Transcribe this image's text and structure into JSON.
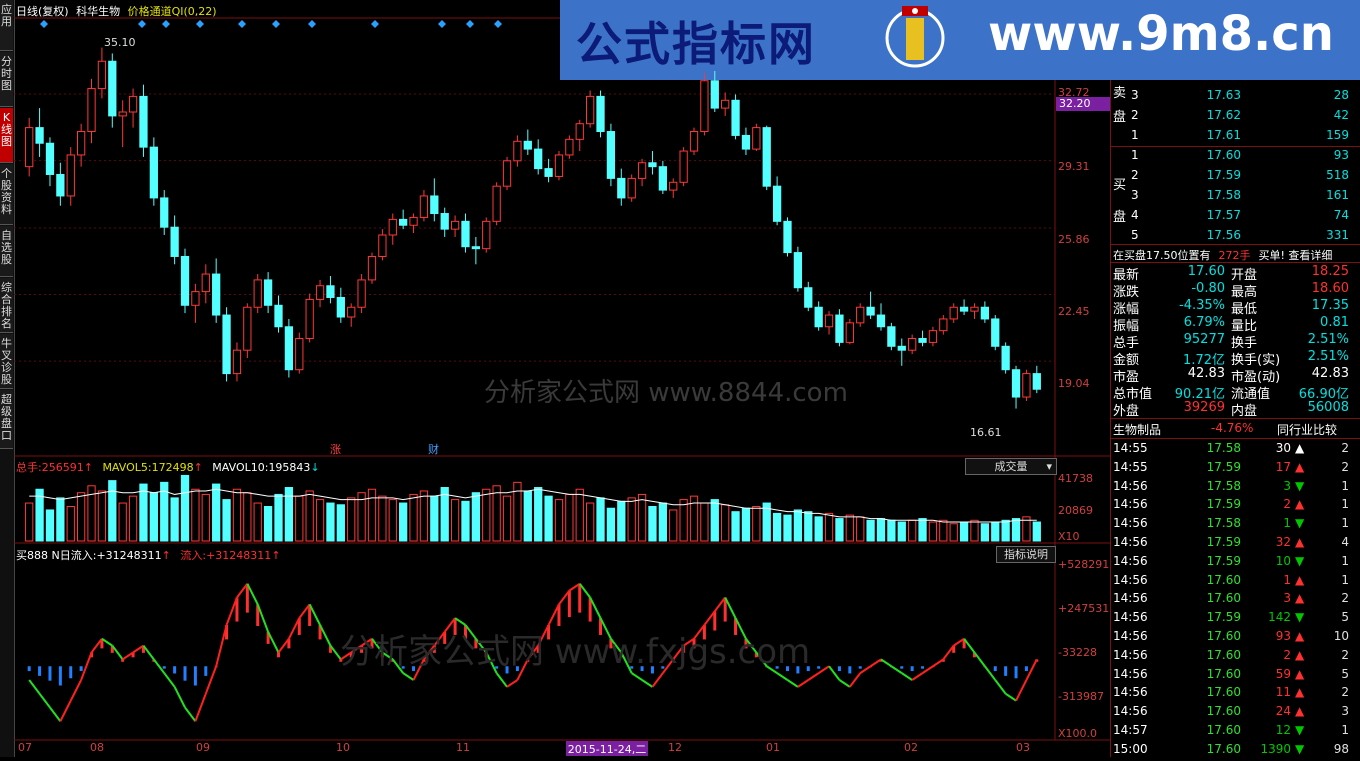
{
  "left_tabs": [
    {
      "label": "应用",
      "active": false
    },
    {
      "label": "分时图",
      "active": false
    },
    {
      "label": "K线图",
      "active": true
    },
    {
      "label": "个股资料",
      "active": false
    },
    {
      "label": "自选股",
      "active": false
    },
    {
      "label": "综合排名",
      "active": false
    },
    {
      "label": "牛叉诊股",
      "active": false
    },
    {
      "label": "超级盘口",
      "active": false
    }
  ],
  "header": {
    "period": "日线(复权)",
    "stock": "科华生物",
    "indicator": "价格通道QI(0,22)"
  },
  "banner": {
    "title": "公式指标网",
    "url": "www.9m8.cn",
    "logo_text": "www.9m8.cn"
  },
  "price_axis": {
    "labels": [
      "32.72",
      "29.31",
      "25.86",
      "22.45",
      "19.04"
    ],
    "current": "32.20"
  },
  "price_range": {
    "min": 15.0,
    "max": 36.0
  },
  "annotations": {
    "high": "35.10",
    "low": "16.61",
    "marker1": "涨",
    "marker2": "财"
  },
  "watermark1": "分析家公式网 www.8844.com",
  "watermark2": "分析家公式网 www.fxjgs.com",
  "volume_header": {
    "total_label": "总手:",
    "total_value": "256591",
    "mavol5_label": "MAVOL5:",
    "mavol5_value": "172498",
    "mavol10_label": "MAVOL10:",
    "mavol10_value": "195843",
    "dropdown": "成交量"
  },
  "volume_axis": {
    "labels": [
      "41738",
      "20869"
    ],
    "multiplier": "X10"
  },
  "indicator_header": {
    "name": "买888",
    "n_label": "N日流入:",
    "n_value": "+31248311",
    "flow_label": "流入:",
    "flow_value": "+31248311",
    "help_button": "指标说明"
  },
  "indicator_axis": {
    "labels": [
      "+528291",
      "+247531",
      "-33228",
      "-313987"
    ],
    "multiplier": "X100.0"
  },
  "x_axis": {
    "labels": [
      "07",
      "08",
      "09",
      "10",
      "11",
      "12",
      "01",
      "02",
      "03"
    ],
    "cursor_date": "2015-11-24,二"
  },
  "chart_data": {
    "type": "candlestick",
    "title": "科华生物 日线(复权)",
    "candles": [
      [
        29.0,
        31.5,
        28.5,
        31.0
      ],
      [
        31.0,
        32.0,
        29.5,
        30.2
      ],
      [
        30.2,
        30.5,
        28.0,
        28.6
      ],
      [
        28.6,
        29.2,
        27.0,
        27.5
      ],
      [
        27.5,
        30.0,
        27.0,
        29.6
      ],
      [
        29.6,
        31.2,
        29.0,
        30.8
      ],
      [
        30.8,
        33.5,
        30.2,
        33.0
      ],
      [
        33.0,
        35.1,
        32.5,
        34.4
      ],
      [
        34.4,
        34.8,
        31.0,
        31.6
      ],
      [
        31.6,
        32.4,
        30.0,
        31.8
      ],
      [
        31.8,
        33.0,
        31.0,
        32.6
      ],
      [
        32.6,
        33.2,
        29.5,
        30.0
      ],
      [
        30.0,
        30.5,
        27.0,
        27.4
      ],
      [
        27.4,
        27.8,
        25.5,
        25.9
      ],
      [
        25.9,
        26.5,
        24.0,
        24.4
      ],
      [
        24.4,
        24.8,
        21.5,
        21.9
      ],
      [
        21.9,
        23.0,
        21.0,
        22.6
      ],
      [
        22.6,
        24.0,
        22.0,
        23.5
      ],
      [
        23.5,
        24.3,
        21.0,
        21.4
      ],
      [
        21.4,
        21.8,
        18.0,
        18.4
      ],
      [
        18.4,
        20.0,
        18.0,
        19.6
      ],
      [
        19.6,
        22.0,
        19.2,
        21.8
      ],
      [
        21.8,
        23.5,
        21.5,
        23.2
      ],
      [
        23.2,
        23.6,
        21.5,
        21.9
      ],
      [
        21.9,
        22.4,
        20.5,
        20.8
      ],
      [
        20.8,
        21.2,
        18.2,
        18.6
      ],
      [
        18.6,
        20.5,
        18.4,
        20.2
      ],
      [
        20.2,
        22.5,
        20.0,
        22.2
      ],
      [
        22.2,
        23.2,
        21.8,
        22.9
      ],
      [
        22.9,
        23.4,
        22.0,
        22.3
      ],
      [
        22.3,
        22.8,
        21.0,
        21.3
      ],
      [
        21.3,
        22.0,
        20.8,
        21.8
      ],
      [
        21.8,
        23.5,
        21.5,
        23.2
      ],
      [
        23.2,
        24.6,
        23.0,
        24.4
      ],
      [
        24.4,
        25.8,
        24.2,
        25.5
      ],
      [
        25.5,
        26.6,
        25.0,
        26.3
      ],
      [
        26.3,
        26.8,
        25.8,
        26.0
      ],
      [
        26.0,
        26.6,
        25.6,
        26.4
      ],
      [
        26.4,
        27.8,
        26.2,
        27.5
      ],
      [
        27.5,
        28.4,
        26.2,
        26.6
      ],
      [
        26.6,
        26.9,
        25.4,
        25.8
      ],
      [
        25.8,
        26.5,
        25.4,
        26.2
      ],
      [
        26.2,
        26.6,
        24.6,
        24.9
      ],
      [
        24.9,
        25.4,
        24.0,
        24.8
      ],
      [
        24.8,
        26.4,
        24.6,
        26.2
      ],
      [
        26.2,
        28.2,
        26.0,
        28.0
      ],
      [
        28.0,
        29.5,
        27.8,
        29.3
      ],
      [
        29.3,
        30.6,
        29.0,
        30.3
      ],
      [
        30.3,
        30.9,
        29.6,
        29.9
      ],
      [
        29.9,
        30.4,
        28.6,
        28.9
      ],
      [
        28.9,
        29.4,
        28.2,
        28.5
      ],
      [
        28.5,
        29.8,
        28.3,
        29.6
      ],
      [
        29.6,
        30.6,
        29.4,
        30.4
      ],
      [
        30.4,
        31.4,
        29.8,
        31.2
      ],
      [
        31.2,
        32.9,
        31.0,
        32.6
      ],
      [
        32.6,
        32.9,
        30.5,
        30.8
      ],
      [
        30.8,
        31.2,
        28.0,
        28.4
      ],
      [
        28.4,
        28.9,
        27.0,
        27.4
      ],
      [
        27.4,
        28.6,
        27.2,
        28.4
      ],
      [
        28.4,
        29.4,
        28.0,
        29.2
      ],
      [
        29.2,
        29.8,
        28.6,
        29.0
      ],
      [
        29.0,
        29.3,
        27.6,
        27.8
      ],
      [
        27.8,
        28.4,
        27.4,
        28.2
      ],
      [
        28.2,
        30.0,
        28.0,
        29.8
      ],
      [
        29.8,
        31.0,
        29.6,
        30.8
      ],
      [
        30.8,
        33.8,
        30.6,
        33.4
      ],
      [
        33.4,
        33.9,
        31.8,
        32.0
      ],
      [
        32.0,
        32.8,
        31.6,
        32.4
      ],
      [
        32.4,
        32.7,
        30.4,
        30.6
      ],
      [
        30.6,
        31.0,
        29.6,
        29.9
      ],
      [
        29.9,
        31.2,
        29.8,
        31.0
      ],
      [
        31.0,
        31.1,
        27.8,
        28.0
      ],
      [
        28.0,
        28.5,
        26.0,
        26.2
      ],
      [
        26.2,
        26.4,
        24.4,
        24.6
      ],
      [
        24.6,
        24.9,
        22.6,
        22.8
      ],
      [
        22.8,
        23.1,
        21.6,
        21.8
      ],
      [
        21.8,
        22.1,
        20.6,
        20.8
      ],
      [
        20.8,
        21.6,
        20.4,
        21.4
      ],
      [
        21.4,
        21.7,
        19.8,
        20.0
      ],
      [
        20.0,
        21.2,
        19.9,
        21.0
      ],
      [
        21.0,
        22.0,
        20.8,
        21.8
      ],
      [
        21.8,
        22.6,
        21.2,
        21.4
      ],
      [
        21.4,
        22.0,
        20.6,
        20.8
      ],
      [
        20.8,
        21.0,
        19.6,
        19.8
      ],
      [
        19.8,
        20.2,
        18.8,
        19.6
      ],
      [
        19.6,
        20.4,
        19.4,
        20.2
      ],
      [
        20.2,
        20.6,
        19.8,
        20.0
      ],
      [
        20.0,
        20.8,
        19.8,
        20.6
      ],
      [
        20.6,
        21.4,
        20.4,
        21.2
      ],
      [
        21.2,
        22.0,
        21.0,
        21.8
      ],
      [
        21.8,
        22.2,
        21.4,
        21.6
      ],
      [
        21.6,
        22.0,
        21.2,
        21.8
      ],
      [
        21.8,
        22.1,
        21.0,
        21.2
      ],
      [
        21.2,
        21.4,
        19.6,
        19.8
      ],
      [
        19.8,
        20.0,
        18.4,
        18.6
      ],
      [
        18.6,
        18.8,
        16.61,
        17.2
      ],
      [
        17.2,
        18.6,
        17.0,
        18.4
      ],
      [
        18.4,
        18.8,
        17.4,
        17.6
      ]
    ],
    "volume": [
      22,
      30,
      18,
      25,
      20,
      28,
      32,
      29,
      35,
      22,
      26,
      33,
      28,
      34,
      25,
      38,
      30,
      27,
      33,
      24,
      30,
      28,
      22,
      20,
      27,
      31,
      26,
      29,
      24,
      22,
      21,
      25,
      28,
      30,
      26,
      24,
      22,
      27,
      29,
      26,
      31,
      24,
      23,
      28,
      30,
      32,
      26,
      34,
      29,
      31,
      26,
      24,
      27,
      30,
      22,
      25,
      19,
      23,
      25,
      27,
      20,
      22,
      18,
      24,
      26,
      22,
      24,
      21,
      17,
      19,
      20,
      22,
      16,
      15,
      18,
      17,
      14,
      16,
      13,
      15,
      14,
      12,
      13,
      12,
      11,
      12,
      13,
      11,
      12,
      10,
      11,
      12,
      10,
      11,
      12,
      13,
      14,
      11
    ],
    "mavol5": [
      26,
      26,
      25,
      24,
      25,
      26,
      27,
      28,
      29,
      28,
      28,
      29,
      28,
      29,
      27,
      28,
      29,
      29,
      30,
      29,
      28,
      28,
      27,
      26,
      26,
      26,
      26,
      27,
      26,
      25,
      24,
      24,
      24,
      25,
      25,
      25,
      24,
      25,
      26,
      26,
      27,
      26,
      25,
      26,
      27,
      28,
      28,
      29,
      29,
      30,
      29,
      28,
      27,
      27,
      26,
      25,
      24,
      23,
      23,
      24,
      23,
      22,
      21,
      21,
      22,
      22,
      22,
      21,
      20,
      19,
      19,
      19,
      18,
      17,
      17,
      16,
      16,
      15,
      14,
      14,
      14,
      13,
      13,
      12,
      12,
      12,
      12,
      12,
      11,
      11,
      11,
      11,
      11,
      11,
      11,
      12,
      12,
      12
    ],
    "indicator": [
      -2,
      -4,
      -6,
      -8,
      -5,
      -2,
      2,
      4,
      3,
      1,
      2,
      3,
      1,
      -1,
      -3,
      -6,
      -8,
      -4,
      0,
      6,
      10,
      12,
      9,
      5,
      2,
      4,
      7,
      9,
      6,
      3,
      1,
      2,
      3,
      4,
      2,
      1,
      -1,
      -2,
      1,
      3,
      5,
      7,
      6,
      4,
      2,
      -1,
      -3,
      -2,
      1,
      3,
      6,
      9,
      11,
      12,
      10,
      7,
      4,
      2,
      -1,
      -2,
      -3,
      -1,
      1,
      3,
      4,
      6,
      8,
      10,
      7,
      4,
      2,
      0,
      -1,
      -2,
      -3,
      -2,
      -1,
      0,
      -2,
      -3,
      -1,
      0,
      1,
      0,
      -1,
      -2,
      -1,
      0,
      1,
      3,
      4,
      2,
      0,
      -2,
      -4,
      -5,
      -2,
      1
    ]
  }
}
